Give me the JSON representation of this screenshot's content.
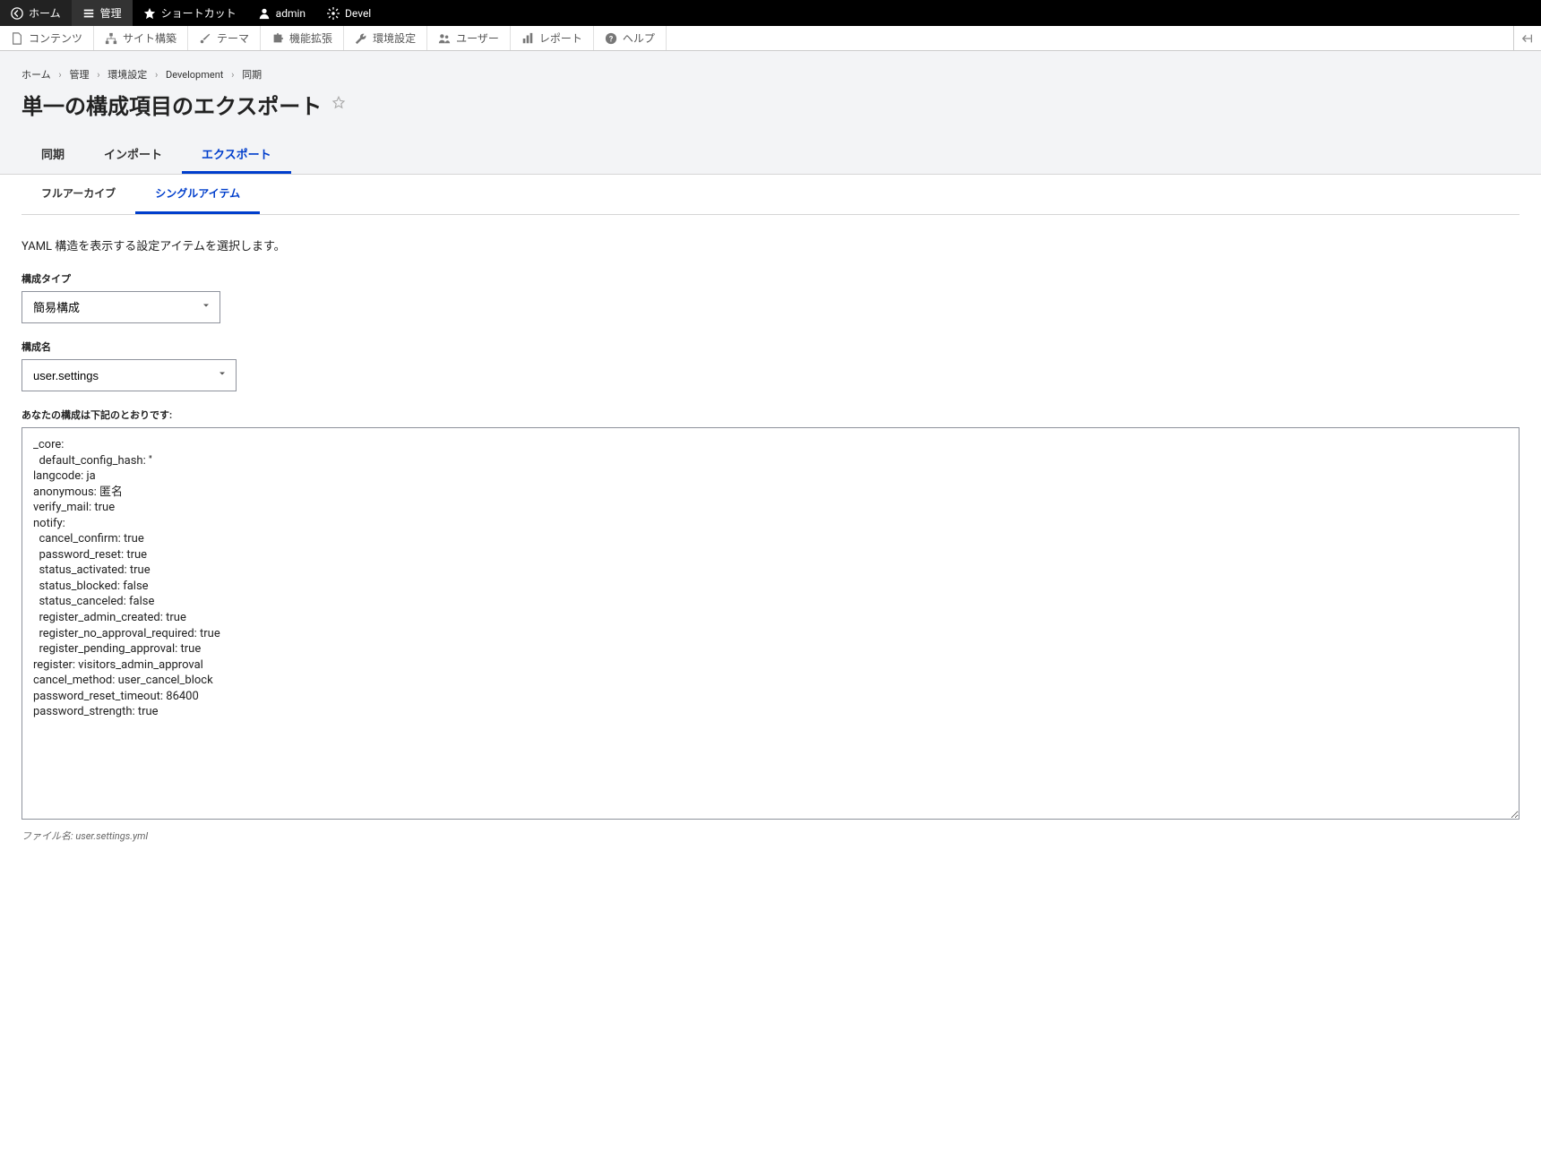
{
  "toolbar_top": {
    "home": "ホーム",
    "manage": "管理",
    "shortcuts": "ショートカット",
    "user": "admin",
    "devel": "Devel"
  },
  "toolbar_second": {
    "content": "コンテンツ",
    "structure": "サイト構築",
    "appearance": "テーマ",
    "extend": "機能拡張",
    "configuration": "環境設定",
    "people": "ユーザー",
    "reports": "レポート",
    "help": "ヘルプ"
  },
  "breadcrumb": {
    "home": "ホーム",
    "manage": "管理",
    "configuration": "環境設定",
    "development": "Development",
    "sync": "同期"
  },
  "page_title": "単一の構成項目のエクスポート",
  "primary_tabs": {
    "sync": "同期",
    "import": "インポート",
    "export": "エクスポート"
  },
  "secondary_tabs": {
    "full_archive": "フルアーカイブ",
    "single_item": "シングルアイテム"
  },
  "description": "YAML 構造を表示する設定アイテムを選択します。",
  "form": {
    "config_type_label": "構成タイプ",
    "config_type_value": "簡易構成",
    "config_name_label": "構成名",
    "config_name_value": "user.settings",
    "config_output_label": "あなたの構成は下記のとおりです:",
    "config_output_value": "_core:\n  default_config_hash: ''\nlangcode: ja\nanonymous: 匿名\nverify_mail: true\nnotify:\n  cancel_confirm: true\n  password_reset: true\n  status_activated: true\n  status_blocked: false\n  status_canceled: false\n  register_admin_created: true\n  register_no_approval_required: true\n  register_pending_approval: true\nregister: visitors_admin_approval\ncancel_method: user_cancel_block\npassword_reset_timeout: 86400\npassword_strength: true\n",
    "file_hint_prefix": "ファイル名: ",
    "file_hint_name": "user.settings.yml"
  }
}
